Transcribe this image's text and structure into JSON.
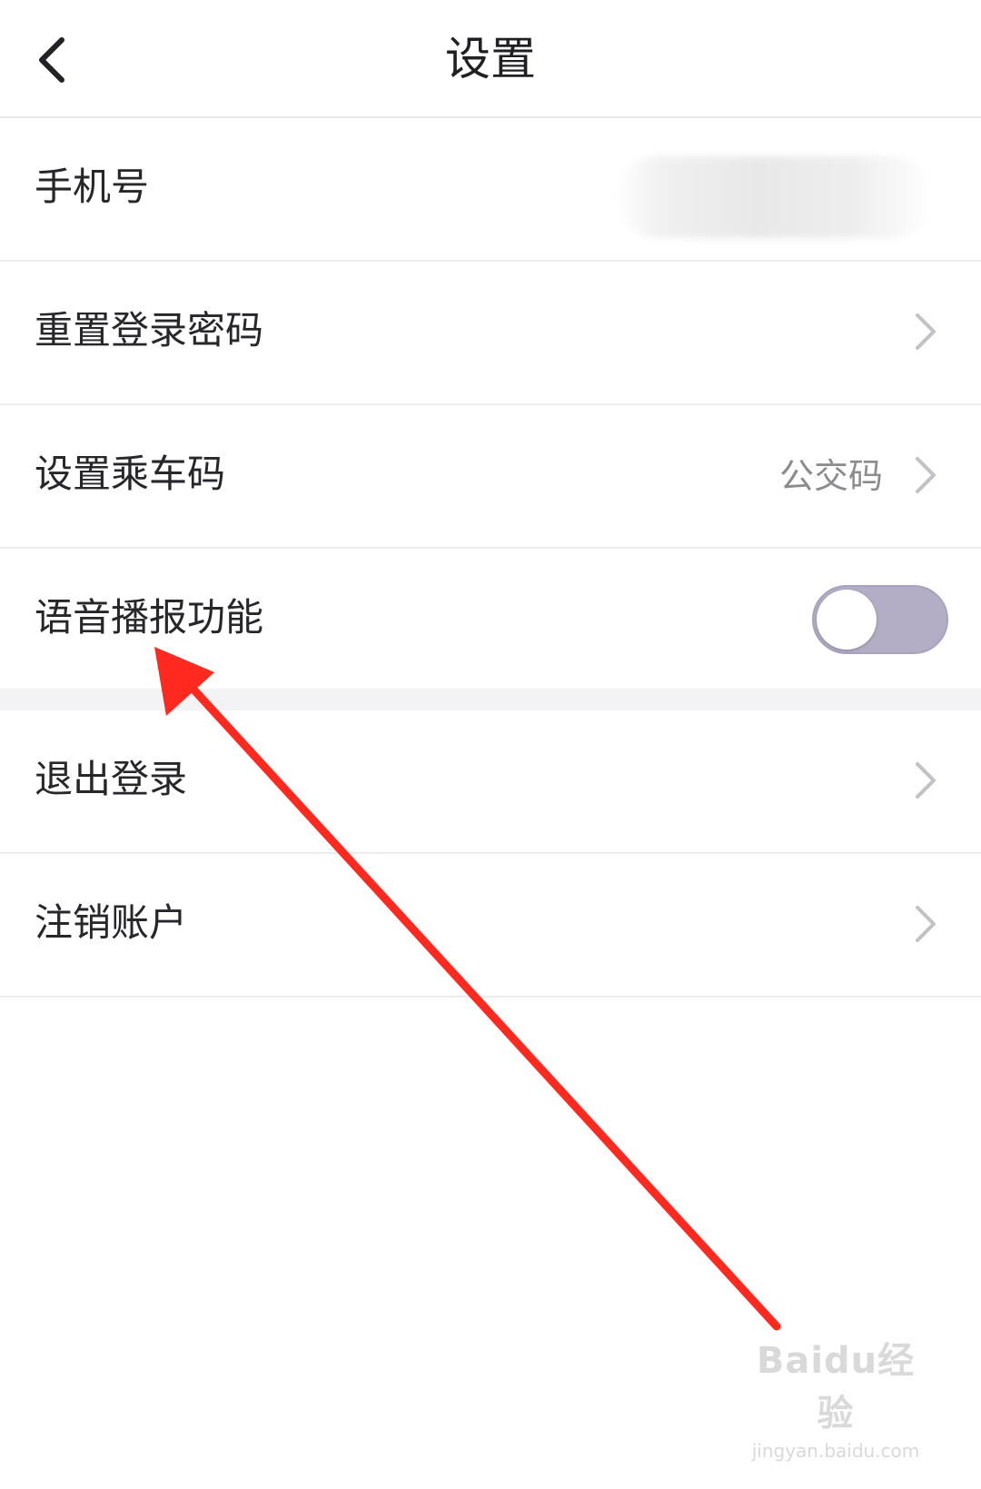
{
  "header": {
    "title": "设置",
    "back_icon": "chevron-left-icon"
  },
  "rows": [
    {
      "label": "手机号",
      "value": ""
    },
    {
      "label": "重置登录密码"
    },
    {
      "label": "设置乘车码",
      "value": "公交码"
    },
    {
      "label": "语音播报功能",
      "toggle_on": false
    }
  ],
  "rows2": [
    {
      "label": "退出登录"
    },
    {
      "label": "注销账户"
    }
  ],
  "colors": {
    "toggle_track": "#b3adc6",
    "arrow": "#ff2a1f",
    "chevron": "#c2c2c6"
  },
  "watermark": {
    "logo": "Baidu经验",
    "url": "jingyan.baidu.com"
  }
}
